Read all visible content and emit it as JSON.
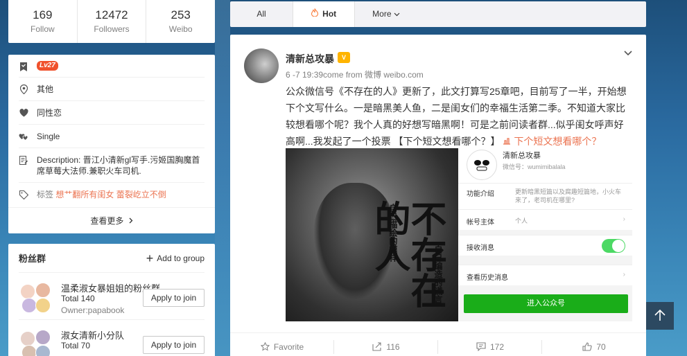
{
  "stats": [
    {
      "num": "169",
      "label": "Follow"
    },
    {
      "num": "12472",
      "label": "Followers"
    },
    {
      "num": "253",
      "label": "Weibo"
    }
  ],
  "profile": {
    "level": "Lv27",
    "location": "其他",
    "orientation": "同性恋",
    "relationship": "Single",
    "description": "Description: 晋江小清新gl写手.污姬国胸魔首席草莓大法师.兼职火车司机.",
    "tags_label": "标签",
    "tags": "想艹翻所有闺女 蕾裂屹立不倒",
    "more": "查看更多"
  },
  "fans": {
    "title": "粉丝群",
    "add_group": "Add to group",
    "groups": [
      {
        "name": "温柔淑女暴姐姐的粉丝群",
        "total": "Total 140",
        "owner": "Owner:papabook",
        "join": "Apply to join"
      },
      {
        "name": "淑女清新小分队",
        "total": "Total 70",
        "join": "Apply to join"
      }
    ]
  },
  "tabs": {
    "all": "All",
    "hot": "Hot",
    "more": "More"
  },
  "post": {
    "author": "清新总攻暴",
    "meta": "6 -7 19:39come from 微博 weibo.com",
    "text": "公众微信号《不存在的人》更新了，此文打算写25章吧，目前写了一半，开始想下个文写什么。一是暗黑美人鱼，二是闺女们的幸福生活第二季。不知道大家比较想看哪个呢？我个人真的好想写暗黑啊！可是之前问读者群...似乎闺女呼声好高啊...我发起了一个投票 【下个短文想看哪个？】 ",
    "vote_link": "下个短文想看哪个？",
    "poster": {
      "title": "不存在的人",
      "sub1": "自己描绘的模样",
      "sub2": "自己编造的谎言"
    },
    "wechat": {
      "name": "清新总攻暴",
      "id": "微信号：wumimibalala",
      "intro_k": "功能介绍",
      "intro_v": "更新暗黑短篇以及腐趣短篇地，小火车来了，老司机在哪里?",
      "subject_k": "帐号主体",
      "subject_v": "个人",
      "receive_k": "接收消息",
      "history_k": "查看历史消息",
      "enter_btn": "进入公众号"
    },
    "actions": {
      "favorite": "Favorite",
      "repost": "116",
      "comment": "172",
      "like": "70"
    }
  },
  "colors": {
    "accent": "#eb7350",
    "wechat_green": "#1aad19",
    "toggle_green": "#4cd964",
    "level_badge": "#f0522d"
  }
}
